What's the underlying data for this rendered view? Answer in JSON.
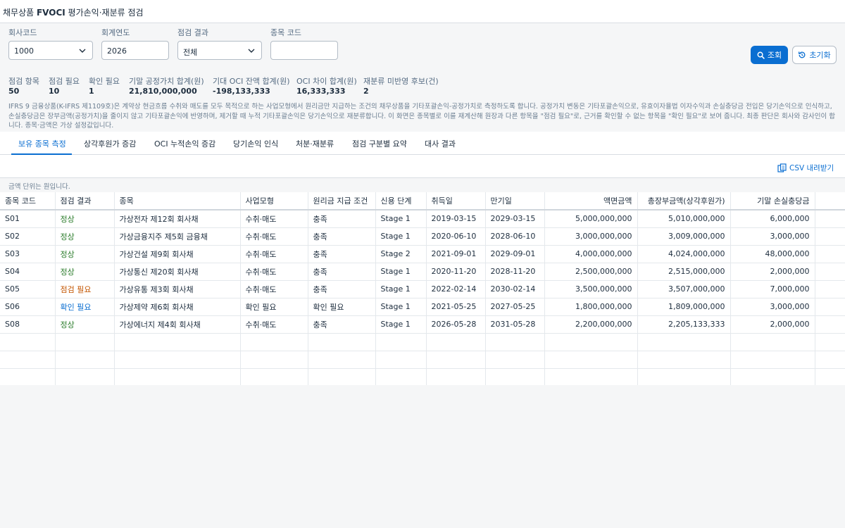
{
  "title": {
    "prefix": "채무상품 ",
    "bold": "FVOCI",
    "suffix": " 평가손익·재분류 점검"
  },
  "filters": {
    "company_code": {
      "label": "회사코드",
      "value": "1000"
    },
    "fiscal_year": {
      "label": "회계연도",
      "value": "2026"
    },
    "check_result": {
      "label": "점검 결과",
      "value": "전체"
    },
    "item_code": {
      "label": "종목 코드",
      "value": ""
    }
  },
  "buttons": {
    "search": "조회",
    "reset": "초기화"
  },
  "kpis": [
    {
      "label": "점검 항목",
      "value": "50"
    },
    {
      "label": "점검 필요",
      "value": "10"
    },
    {
      "label": "확인 필요",
      "value": "1"
    },
    {
      "label": "기말 공정가치 합계(원)",
      "value": "21,810,000,000"
    },
    {
      "label": "기대 OCI 잔액 합계(원)",
      "value": "-198,133,333"
    },
    {
      "label": "OCI 차이 합계(원)",
      "value": "16,333,333"
    },
    {
      "label": "재분류 미반영 후보(건)",
      "value": "2"
    }
  ],
  "description": "IFRS 9 금융상품(K-IFRS 제1109호)은 계약상 현금흐름 수취와 매도를 모두 목적으로 하는 사업모형에서 원리금만 지급하는 조건의 채무상품을 기타포괄손익-공정가치로 측정하도록 합니다. 공정가치 변동은 기타포괄손익으로, 유효이자율법 이자수익과 손실충당금 전입은 당기손익으로 인식하고, 손실충당금은 장부금액(공정가치)을 줄이지 않고 기타포괄손익에 반영하며, 제거할 때 누적 기타포괄손익은 당기손익으로 재분류합니다. 이 화면은 종목별로 이를 재계산해 원장과 다른 항목을 \"점검 필요\"로, 근거를 확인할 수 없는 항목을 \"확인 필요\"로 보여 줍니다. 최종 판단은 회사와 감사인이 합니다. 종목·금액은 가상 설정값입니다.",
  "tabs": [
    "보유 종목 측정",
    "상각후원가 증감",
    "OCI 누적손익 증감",
    "당기손익 인식",
    "처분·재분류",
    "점검 구분별 요약",
    "대사 결과"
  ],
  "csv_label": "CSV 내려받기",
  "unit_note": "금액 단위는 원입니다.",
  "table": {
    "headers": [
      "종목 코드",
      "점검 결과",
      "종목",
      "사업모형",
      "원리금 지급 조건",
      "신용 단계",
      "취득일",
      "만기일",
      "액면금액",
      "총장부금액(상각후원가)",
      "기말 손실충당금"
    ],
    "rows": [
      [
        "S01",
        "정상",
        "가상전자 제12회 회사채",
        "수취·매도",
        "충족",
        "Stage 1",
        "2019-03-15",
        "2029-03-15",
        "5,000,000,000",
        "5,010,000,000",
        "6,000,000"
      ],
      [
        "S02",
        "정상",
        "가상금융지주 제5회 금융채",
        "수취·매도",
        "충족",
        "Stage 1",
        "2020-06-10",
        "2028-06-10",
        "3,000,000,000",
        "3,009,000,000",
        "3,000,000"
      ],
      [
        "S03",
        "정상",
        "가상건설 제9회 회사채",
        "수취·매도",
        "충족",
        "Stage 2",
        "2021-09-01",
        "2029-09-01",
        "4,000,000,000",
        "4,024,000,000",
        "48,000,000"
      ],
      [
        "S04",
        "정상",
        "가상통신 제20회 회사채",
        "수취·매도",
        "충족",
        "Stage 1",
        "2020-11-20",
        "2028-11-20",
        "2,500,000,000",
        "2,515,000,000",
        "2,000,000"
      ],
      [
        "S05",
        "점검 필요",
        "가상유통 제3회 회사채",
        "수취·매도",
        "충족",
        "Stage 1",
        "2022-02-14",
        "2030-02-14",
        "3,500,000,000",
        "3,507,000,000",
        "7,000,000"
      ],
      [
        "S06",
        "확인 필요",
        "가상제약 제6회 회사채",
        "확인 필요",
        "확인 필요",
        "Stage 1",
        "2021-05-25",
        "2027-05-25",
        "1,800,000,000",
        "1,809,000,000",
        "3,000,000"
      ],
      [
        "S08",
        "정상",
        "가상에너지 제4회 회사채",
        "수취·매도",
        "충족",
        "Stage 1",
        "2026-05-28",
        "2031-05-28",
        "2,200,000,000",
        "2,205,133,333",
        "2,000,000"
      ]
    ]
  },
  "colors": {
    "accent": "#0a6ed1",
    "ok": "#2b7c2b",
    "check": "#c35500",
    "confirm": "#0a6ed1"
  }
}
